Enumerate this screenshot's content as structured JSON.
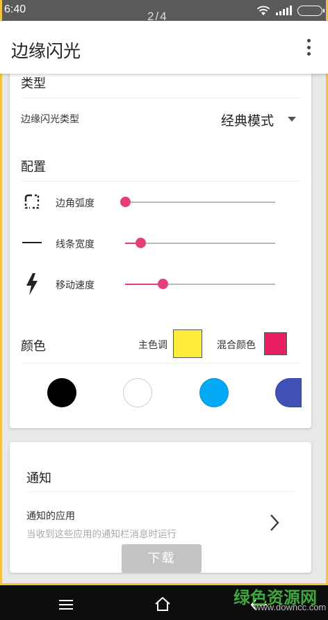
{
  "status_bar": {
    "time": "6:40",
    "page_indicator": "2/4"
  },
  "app_bar": {
    "title": "边缘闪光"
  },
  "type_section": {
    "title": "类型",
    "edge_flash_type_label": "边缘闪光类型",
    "edge_flash_type_value": "经典模式"
  },
  "config_section": {
    "title": "配置",
    "sliders": [
      {
        "label": "边角弧度",
        "icon": "rounded-corner-icon",
        "value": 0.0
      },
      {
        "label": "线条宽度",
        "icon": "line-width-icon",
        "value": 0.1
      },
      {
        "label": "移动速度",
        "icon": "lightning-bolt-icon",
        "value": 0.25
      }
    ],
    "accent_color": "#e63e7b"
  },
  "color_section": {
    "title": "颜色",
    "primary_label": "主色调",
    "primary_color": "#fdea3a",
    "mix_label": "混合颜色",
    "mix_color": "#e91e63",
    "palette": [
      "#000000",
      "#ffffff",
      "#03a9f4",
      "#3f51b5"
    ]
  },
  "notification_section": {
    "title": "通知",
    "apps_title": "通知的应用",
    "apps_subtitle": "当收到这些应用的通知栏消息时运行"
  },
  "download_button": "下载",
  "watermark": {
    "main": "绿色资源网",
    "sub": "www.downcc.com"
  }
}
